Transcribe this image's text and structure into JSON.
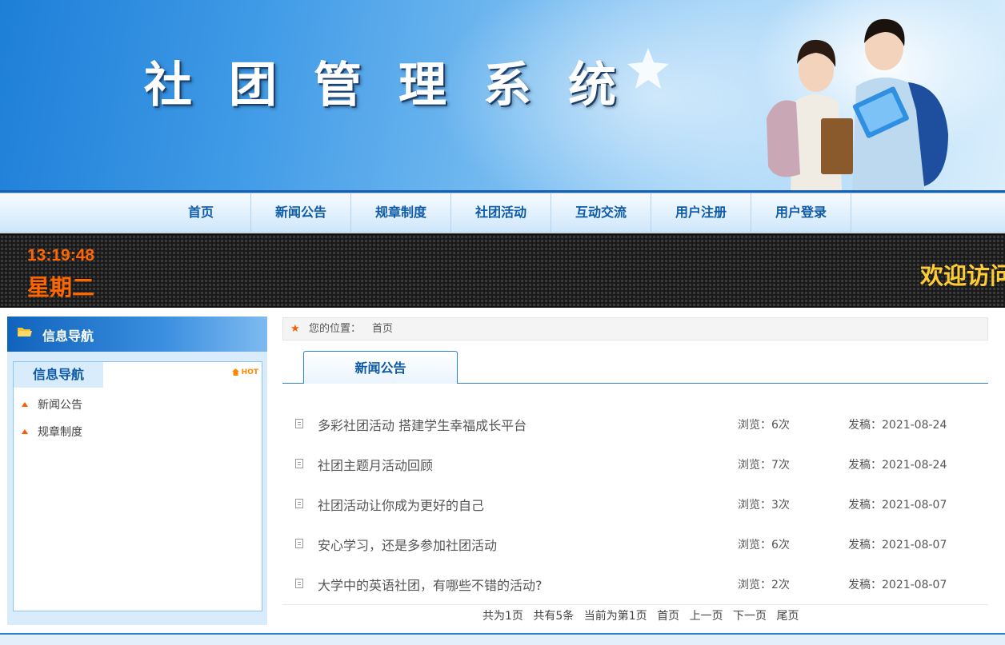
{
  "header": {
    "site_title": "社团管理系统"
  },
  "nav": {
    "items": [
      "首页",
      "新闻公告",
      "规章制度",
      "社团活动",
      "互动交流",
      "用户注册",
      "用户登录"
    ]
  },
  "ticker": {
    "time": "13:19:48",
    "weekday": "星期二",
    "marquee": "欢迎访问"
  },
  "sidebar": {
    "header_title": "信息导航",
    "box_tab": "信息导航",
    "hot_label": "HOT",
    "items": [
      "新闻公告",
      "规章制度"
    ]
  },
  "breadcrumb": {
    "label": "您的位置：",
    "current": "首页"
  },
  "news": {
    "tab": "新闻公告",
    "items": [
      {
        "title": "多彩社团活动 搭建学生幸福成长平台",
        "views": "浏览：6次",
        "date": "发稿：2021-08-24"
      },
      {
        "title": "社团主题月活动回顾",
        "views": "浏览：7次",
        "date": "发稿：2021-08-24"
      },
      {
        "title": "社团活动让你成为更好的自己",
        "views": "浏览：3次",
        "date": "发稿：2021-08-07"
      },
      {
        "title": "安心学习，还是多参加社团活动",
        "views": "浏览：6次",
        "date": "发稿：2021-08-07"
      },
      {
        "title": "大学中的英语社团，有哪些不错的活动?",
        "views": "浏览：2次",
        "date": "发稿：2021-08-07"
      }
    ]
  },
  "pager": {
    "total_pages": "共为1页",
    "total_items": "共有5条",
    "current": "当前为第1页",
    "first": "首页",
    "prev": "上一页",
    "next": "下一页",
    "last": "尾页"
  },
  "colors": {
    "brand_blue": "#0d5aa8",
    "clock_orange": "#ff6600",
    "marquee_yellow": "#ffcc33"
  }
}
